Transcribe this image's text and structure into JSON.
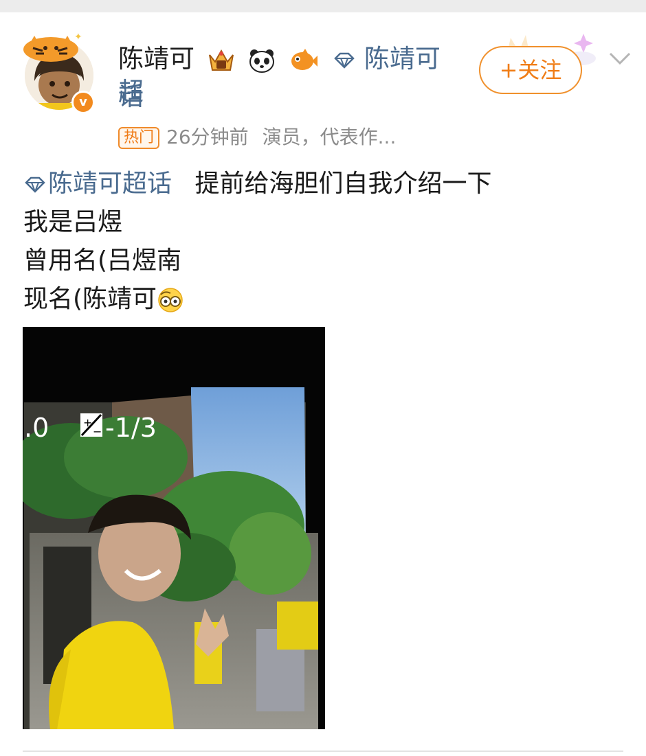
{
  "post": {
    "author": {
      "name": "陈靖可",
      "super_topic_name": "陈靖可超",
      "super_topic_name_tail": "话",
      "verified_mark": "v"
    },
    "follow_button": {
      "plus": "+",
      "label": "关注"
    },
    "meta": {
      "hot_tag": "热门",
      "time": "26分钟前",
      "description": "演员，代表作..."
    },
    "body": {
      "topic_link": "陈靖可超话",
      "line1_text": "提前给海胆们自我介绍一下",
      "line2": "我是吕煜",
      "line3": "曾用名(吕煜南",
      "line4": "现名(陈靖可"
    },
    "photo": {
      "viewfinder_left": ".0",
      "viewfinder_exposure": "-1/3"
    }
  },
  "colors": {
    "accent_orange": "#f07d16",
    "link_blue": "#4a6b8f",
    "meta_gray": "#8b8b8b"
  },
  "icons": [
    "tiger-hat-icon",
    "verified-v-icon",
    "crown-badge-icon",
    "panda-badge-icon",
    "fish-badge-icon",
    "diamond-icon",
    "chevron-down-icon",
    "peeking-emoji-icon",
    "exposure-compensation-icon"
  ]
}
